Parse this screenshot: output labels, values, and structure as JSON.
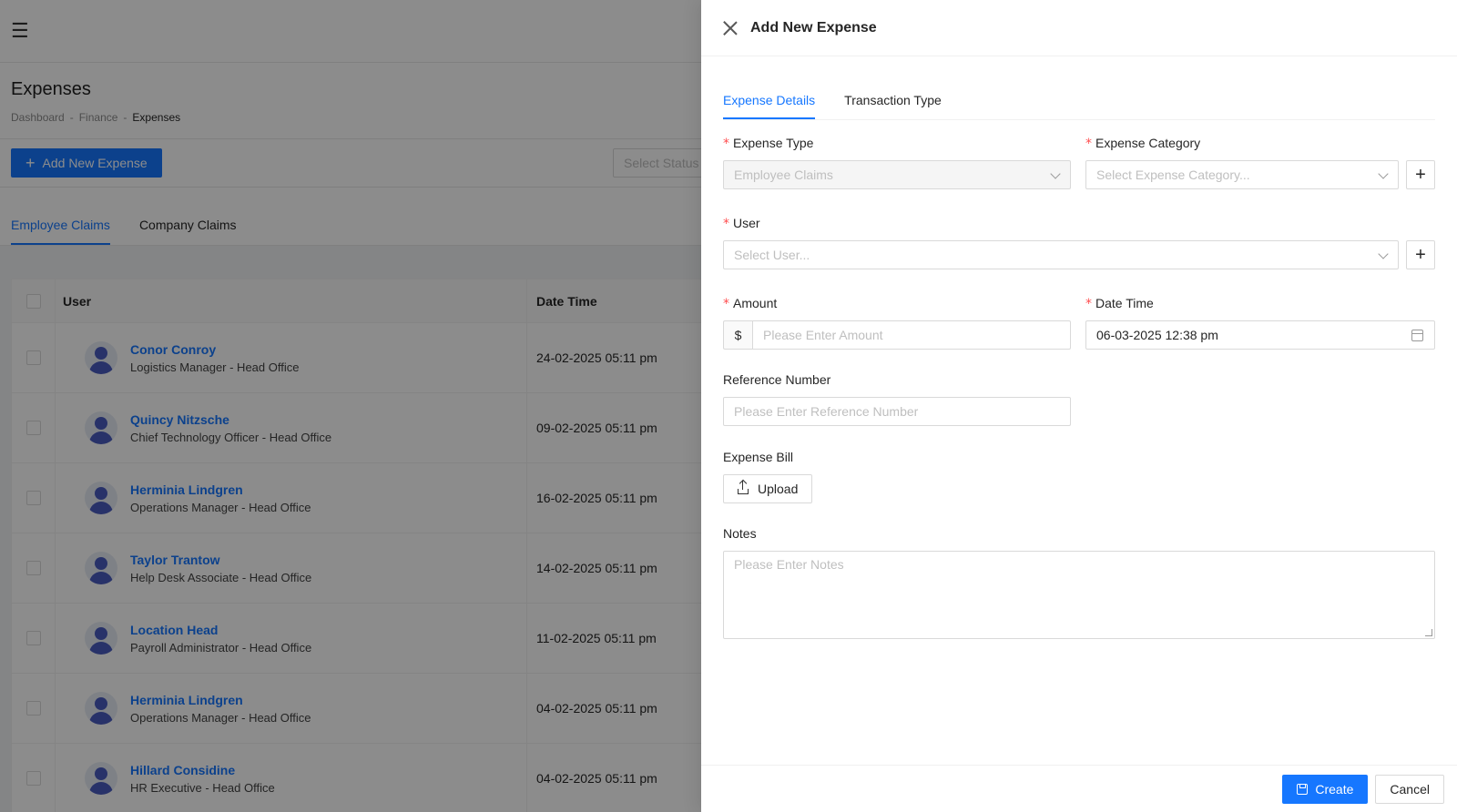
{
  "background": {
    "page_title": "Expenses",
    "breadcrumb": [
      "Dashboard",
      "Finance",
      "Expenses"
    ],
    "add_button_label": "Add New Expense",
    "status_placeholder": "Select Status",
    "tabs": [
      {
        "label": "Employee Claims",
        "active": true
      },
      {
        "label": "Company Claims",
        "active": false
      }
    ],
    "table": {
      "columns": [
        "User",
        "Date Time"
      ],
      "rows": [
        {
          "name": "Conor Conroy",
          "role": "Logistics Manager - Head Office",
          "date": "24-02-2025 05:11 pm"
        },
        {
          "name": "Quincy Nitzsche",
          "role": "Chief Technology Officer - Head Office",
          "date": "09-02-2025 05:11 pm"
        },
        {
          "name": "Herminia Lindgren",
          "role": "Operations Manager - Head Office",
          "date": "16-02-2025 05:11 pm"
        },
        {
          "name": "Taylor Trantow",
          "role": "Help Desk Associate - Head Office",
          "date": "14-02-2025 05:11 pm"
        },
        {
          "name": "Location Head",
          "role": "Payroll Administrator - Head Office",
          "date": "11-02-2025 05:11 pm"
        },
        {
          "name": "Herminia Lindgren",
          "role": "Operations Manager - Head Office",
          "date": "04-02-2025 05:11 pm"
        },
        {
          "name": "Hillard Considine",
          "role": "HR Executive - Head Office",
          "date": "04-02-2025 05:11 pm"
        }
      ]
    }
  },
  "drawer": {
    "title": "Add New Expense",
    "tabs": [
      {
        "label": "Expense Details",
        "active": true
      },
      {
        "label": "Transaction Type",
        "active": false
      }
    ],
    "fields": {
      "expense_type": {
        "label": "Expense Type",
        "value": "Employee Claims",
        "required": true,
        "disabled": true
      },
      "expense_category": {
        "label": "Expense Category",
        "placeholder": "Select Expense Category...",
        "required": true
      },
      "user": {
        "label": "User",
        "placeholder": "Select User...",
        "required": true
      },
      "amount": {
        "label": "Amount",
        "prefix": "$",
        "placeholder": "Please Enter Amount",
        "required": true
      },
      "date_time": {
        "label": "Date Time",
        "value": "06-03-2025 12:38 pm",
        "required": true
      },
      "reference_number": {
        "label": "Reference Number",
        "placeholder": "Please Enter Reference Number"
      },
      "expense_bill": {
        "label": "Expense Bill",
        "button_label": "Upload"
      },
      "notes": {
        "label": "Notes",
        "placeholder": "Please Enter Notes"
      }
    },
    "footer": {
      "create_label": "Create",
      "cancel_label": "Cancel"
    }
  },
  "colors": {
    "primary": "#1677ff",
    "required": "#ff4d4f",
    "overlay": "rgba(0,0,0,0.45)"
  }
}
